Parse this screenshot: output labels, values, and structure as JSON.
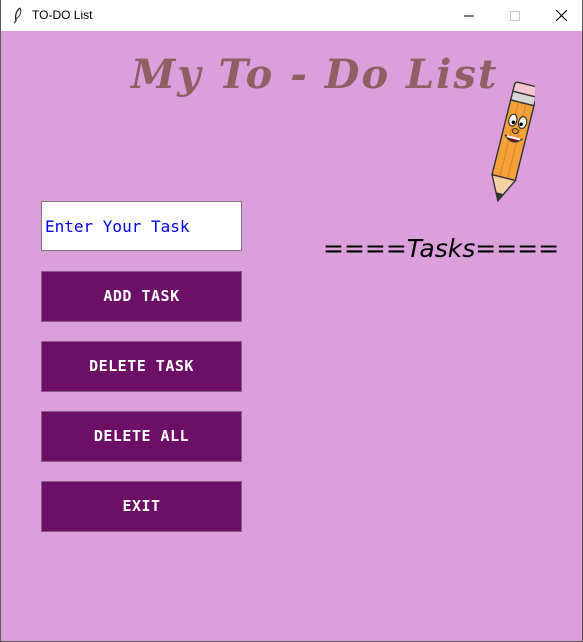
{
  "window": {
    "title": "TO-DO List",
    "controls": {
      "minimize": "—",
      "maximize": "☐",
      "close": "✕"
    }
  },
  "app": {
    "heading": "My To - Do List",
    "input": {
      "value": "",
      "placeholder": "Enter Your Task"
    },
    "buttons": {
      "add": "ADD TASK",
      "delete": "DELETE TASK",
      "delete_all": "DELETE ALL",
      "exit": "EXIT"
    },
    "tasks_header": "====Tasks====",
    "tasks": []
  },
  "colors": {
    "background": "#dba0dc",
    "button": "#6e0f67",
    "heading": "#8e5f63",
    "input_text": "#0000ee"
  },
  "icons": {
    "app": "feather-icon",
    "decoration": "pencil-mascot-icon"
  }
}
